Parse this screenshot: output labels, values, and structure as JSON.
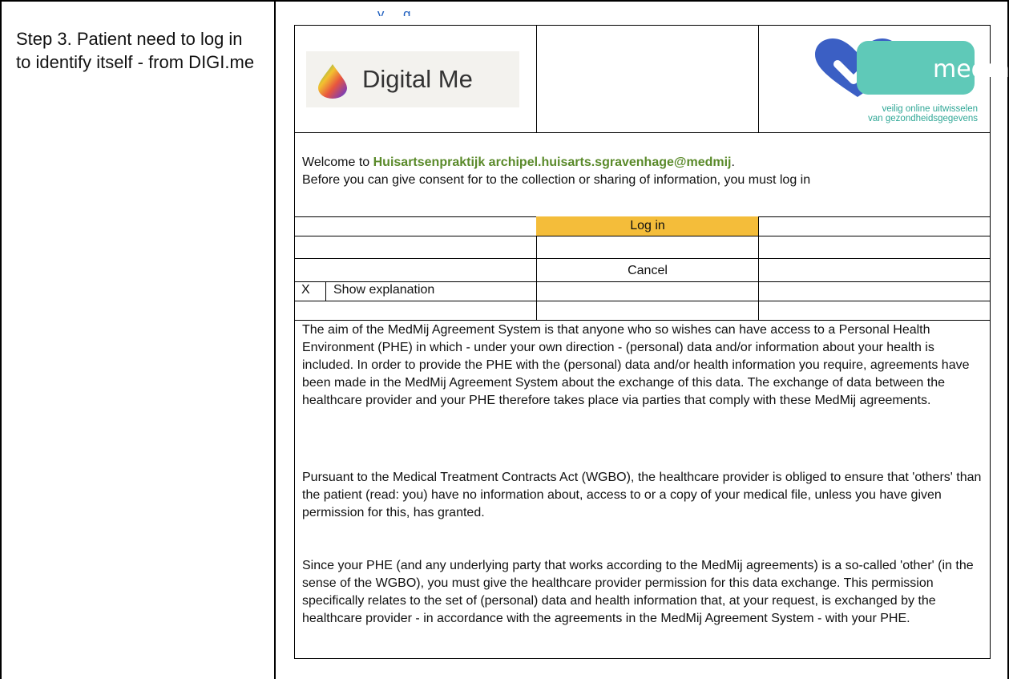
{
  "left_column": {
    "step_text": "Step 3. Patient need to log in to identify itself - from DIGI.me"
  },
  "cutoff_header": "... y ... g ...",
  "logos": {
    "digital_me": "Digital Me",
    "medmij_word": "medmij",
    "medmij_tagline_1": "veilig online uitwisselen",
    "medmij_tagline_2": "van gezondheidsgegevens"
  },
  "welcome": {
    "prefix": "Welcome to ",
    "practice": "Huisartsenpraktijk archipel.huisarts.sgravenhage@medmij",
    "suffix": ".",
    "line2": "Before you can give consent for to the collection or sharing of information, you must log in"
  },
  "actions": {
    "login": "Log in",
    "cancel": "Cancel",
    "checkbox_mark": "X",
    "show_explanation": "Show explanation"
  },
  "explanation": {
    "p1": "The aim of the MedMij Agreement System is that anyone who so wishes can have access to a Personal Health Environment (PHE) in which - under your own direction - (personal) data and/or information about your health is included. In order to provide the PHE with the (personal) data and/or health information you require, agreements have been made in the MedMij Agreement System about the exchange of this data. The exchange of data between the healthcare provider and your PHE therefore takes place via parties that comply with these MedMij agreements.",
    "p2": "Pursuant to the Medical Treatment Contracts Act (WGBO), the healthcare provider is obliged to ensure that 'others' than the patient (read: you) have no information about, access to or a copy of your medical file, unless you have given permission for this, has granted.",
    "p3": "Since your PHE (and any underlying party that works according to the MedMij agreements) is a so-called 'other' (in the sense of the WGBO), you must give the healthcare provider permission for this data exchange. This permission specifically relates to the set of (personal) data and health information that, at your request, is exchanged by the healthcare provider - in accordance with the agreements in the MedMij Agreement System - with your PHE."
  },
  "colors": {
    "login_highlight": "#f4bd3a",
    "practice_name": "#5a8a2a",
    "medmij_teal": "#5fc9b8",
    "medmij_heart": "#3b5fc4"
  }
}
